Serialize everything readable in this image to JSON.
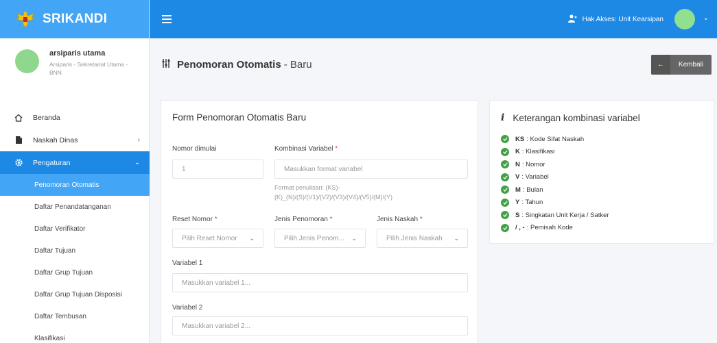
{
  "brand": {
    "name": "SRIKANDI"
  },
  "user": {
    "name": "arsiparis utama",
    "role": "Arsiparis - Sekretariat Utama - BNN"
  },
  "menu": {
    "items": [
      {
        "label": "Beranda"
      },
      {
        "label": "Naskah Dinas"
      },
      {
        "label": "Pengaturan"
      }
    ],
    "submenu": [
      {
        "label": "Penomoran Otomatis"
      },
      {
        "label": "Daftar Penandatanganan"
      },
      {
        "label": "Daftar Verifikator"
      },
      {
        "label": "Daftar Tujuan"
      },
      {
        "label": "Daftar Grup Tujuan"
      },
      {
        "label": "Daftar Grup Tujuan Disposisi"
      },
      {
        "label": "Daftar Tembusan"
      },
      {
        "label": "Klasifikasi"
      }
    ]
  },
  "topbar": {
    "access_label": "Hak Akses: Unit Kearsipan"
  },
  "page": {
    "title_main": "Penomoran Otomatis",
    "title_sub": "- Baru",
    "back_label": "Kembali"
  },
  "form": {
    "title": "Form Penomoran Otomatis Baru",
    "nomor_dimulai": {
      "label": "Nomor dimulai",
      "value": "1"
    },
    "kombinasi": {
      "label": "Kombinasi Variabel",
      "placeholder": "Masukkan format variabel",
      "hint_line1": "Format penulisan: (KS)-",
      "hint_line2": "(K)_(N)/(S)/(V1)/(V2)/(V3)/(V4)/(V5)/(M)/(Y)"
    },
    "reset_nomor": {
      "label": "Reset Nomor",
      "placeholder": "Pilih Reset Nomor"
    },
    "jenis_penomoran": {
      "label": "Jenis Penomoran",
      "placeholder": "Pilih Jenis Penom..."
    },
    "jenis_naskah": {
      "label": "Jenis Naskah",
      "placeholder": "Pilih Jenis Naskah"
    },
    "variabel1": {
      "label": "Variabel 1",
      "placeholder": "Masukkan variabel 1..."
    },
    "variabel2": {
      "label": "Variabel 2",
      "placeholder": "Masukkan variabel 2..."
    },
    "required_mark": "*"
  },
  "info": {
    "title": "Keterangan kombinasi variabel",
    "items": [
      {
        "code": "KS",
        "desc": ": Kode Sifat Naskah"
      },
      {
        "code": "K",
        "desc": ": Klasifikasi"
      },
      {
        "code": "N",
        "desc": ": Nomor"
      },
      {
        "code": "V",
        "desc": ": Variabel"
      },
      {
        "code": "M",
        "desc": ": Bulan"
      },
      {
        "code": "Y",
        "desc": ": Tahun"
      },
      {
        "code": "S",
        "desc": ": Singkatan Unit Kerja / Satker"
      },
      {
        "code": "/ , -",
        "desc": ": Pemisah Kode"
      }
    ]
  },
  "colors": {
    "topbar": "#1e88e5",
    "brand": "#42a5f5",
    "active": "#42a5f5",
    "check": "#43a047",
    "back_button": "#666666"
  },
  "icons": [
    "garuda-logo-icon",
    "hamburger-icon",
    "person-icon",
    "chevron-down-icon",
    "home-icon",
    "document-icon",
    "gear-icon",
    "chevron-right-icon",
    "sliders-icon",
    "arrow-left-icon",
    "info-icon",
    "check-circle-icon"
  ]
}
